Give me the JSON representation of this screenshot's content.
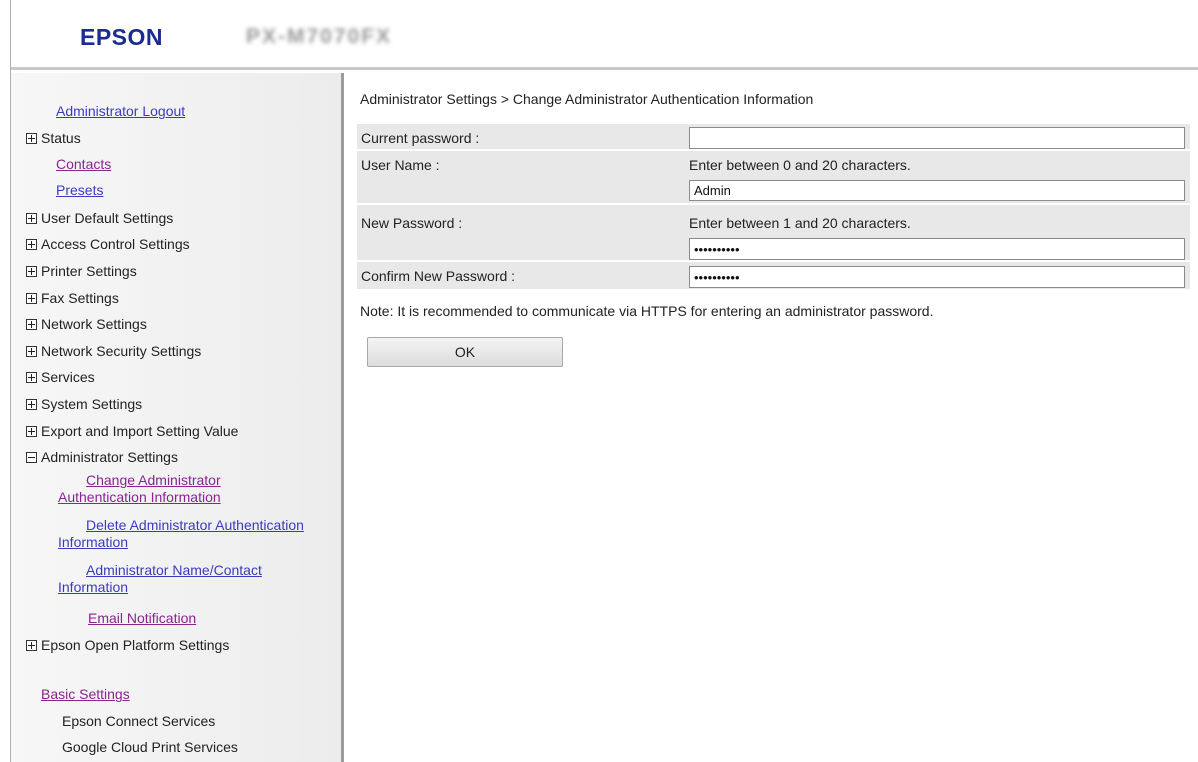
{
  "header": {
    "brand": "EPSON",
    "model": "PX-M7070FX"
  },
  "sidebar": {
    "logout": "Administrator Logout",
    "status": "Status",
    "contacts": "Contacts",
    "presets": "Presets",
    "user_default": "User Default Settings",
    "access_control": "Access Control Settings",
    "printer": "Printer Settings",
    "fax": "Fax Settings",
    "network": "Network Settings",
    "network_security": "Network Security Settings",
    "services": "Services",
    "system": "System Settings",
    "export_import": "Export and Import Setting Value",
    "admin_settings": "Administrator Settings",
    "change_admin_auth": "Change Administrator Authentication Information",
    "delete_admin_auth": "Delete Administrator Authentication Information",
    "admin_name_contact": "Administrator Name/Contact Information",
    "email_notification": "Email Notification",
    "open_platform": "Epson Open Platform Settings",
    "basic_settings": "Basic Settings",
    "epson_connect": "Epson Connect Services",
    "google_cloud": "Google Cloud Print Services"
  },
  "main": {
    "breadcrumb": "Administrator Settings > Change Administrator Authentication Information",
    "current_password_label": "Current password :",
    "current_password_value": "",
    "user_name_label": "User Name :",
    "user_name_hint": "Enter between 0 and 20 characters.",
    "user_name_value": "Admin",
    "new_password_label": "New Password :",
    "new_password_hint": "Enter between 1 and 20 characters.",
    "new_password_value": "••••••••••",
    "confirm_password_label": "Confirm New Password :",
    "confirm_password_value": "••••••••••",
    "note": "Note: It is recommended to communicate via HTTPS for entering an administrator password.",
    "ok_label": "OK"
  },
  "colors": {
    "link": "#3b3bbf",
    "visited_link": "#8a248f",
    "brand": "#1b2c8f"
  }
}
